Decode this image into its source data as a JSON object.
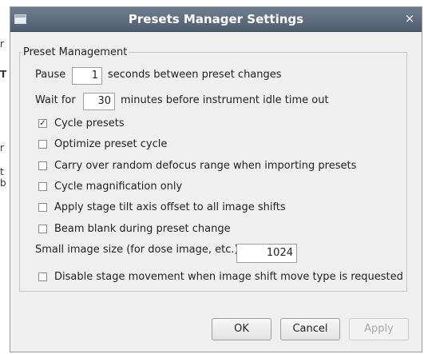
{
  "background": {
    "fragments": [
      "r",
      "T",
      "r",
      "t",
      "b"
    ]
  },
  "dialog": {
    "title": "Presets Manager Settings",
    "close_glyph": "×",
    "group_title": "Preset Management",
    "pause": {
      "prefix": "Pause",
      "value": "1",
      "suffix": "seconds between preset changes"
    },
    "wait": {
      "prefix": "Wait for",
      "value": "30",
      "suffix": "minutes before instrument idle time out"
    },
    "checkboxes": [
      {
        "label": "Cycle presets",
        "checked": true
      },
      {
        "label": "Optimize preset cycle",
        "checked": false
      },
      {
        "label": "Carry over random defocus range when importing presets",
        "checked": false
      },
      {
        "label": "Cycle magnification only",
        "checked": false
      },
      {
        "label": "Apply stage tilt axis offset to all image shifts",
        "checked": false
      },
      {
        "label": "Beam blank during preset change",
        "checked": false
      }
    ],
    "small_image": {
      "label": "Small image size (for dose image, etc.)",
      "value": "1024"
    },
    "disable_stage": {
      "label": "Disable stage movement when image shift move type is requested",
      "checked": false
    },
    "buttons": {
      "ok": "OK",
      "cancel": "Cancel",
      "apply": "Apply"
    }
  }
}
